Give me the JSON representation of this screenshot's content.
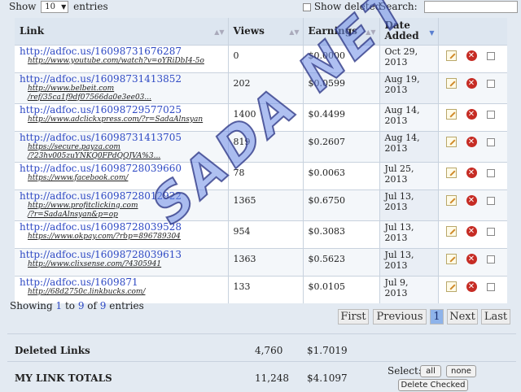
{
  "top": {
    "show_label": "Show",
    "entries_value": "10",
    "entries_label": "entries",
    "show_deleted_label": "Show deleted",
    "search_label": "Search:",
    "search_value": ""
  },
  "table": {
    "headers": {
      "link": "Link",
      "views": "Views",
      "earnings": "Earnings",
      "date_added": "Date Added"
    },
    "rows": [
      {
        "short": "http://adfoc.us/16098731676287",
        "dest": "http://www.youtube.com/watch?v=oYRiDbI4-5o",
        "dest2": "",
        "views": "0",
        "earnings": "$0.0000",
        "date1": "Oct 29,",
        "date2": "2013"
      },
      {
        "short": "http://adfoc.us/16098731413852",
        "dest": "http://www.belbeit.com",
        "dest2": "/ref/35ca1f9df07566da0e3ee03...",
        "views": "202",
        "earnings": "$0.0599",
        "date1": "Aug 19,",
        "date2": "2013"
      },
      {
        "short": "http://adfoc.us/16098729577025",
        "dest": "http://www.adclickxpress.com/?r=SadaAlnsyan",
        "dest2": "",
        "views": "1400",
        "earnings": "$0.4499",
        "date1": "Aug 14,",
        "date2": "2013"
      },
      {
        "short": "http://adfoc.us/16098731413705",
        "dest": "https://secure.payza.com",
        "dest2": "/?23hv005zuYNKQ0FPdQQJVA%3...",
        "views": "819",
        "earnings": "$0.2607",
        "date1": "Aug 14,",
        "date2": "2013"
      },
      {
        "short": "http://adfoc.us/16098728039660",
        "dest": "https://www.facebook.com/",
        "dest2": "",
        "views": "78",
        "earnings": "$0.0063",
        "date1": "Jul 25,",
        "date2": "2013"
      },
      {
        "short": "http://adfoc.us/16098728012922",
        "dest": "http://www.profitclicking.com",
        "dest2": "/?r=SadaAlnsyan&p=op",
        "views": "1365",
        "earnings": "$0.6750",
        "date1": "Jul 13,",
        "date2": "2013"
      },
      {
        "short": "http://adfoc.us/16098728039528",
        "dest": "https://www.okpay.com/?rbp=896789304",
        "dest2": "",
        "views": "954",
        "earnings": "$0.3083",
        "date1": "Jul 13,",
        "date2": "2013"
      },
      {
        "short": "http://adfoc.us/16098728039613",
        "dest": "http://www.clixsense.com/?4305941",
        "dest2": "",
        "views": "1363",
        "earnings": "$0.5623",
        "date1": "Jul 13,",
        "date2": "2013"
      },
      {
        "short": "http://adfoc.us/1609871",
        "dest": "http://68d2750c.linkbucks.com/",
        "dest2": "",
        "views": "133",
        "earnings": "$0.0105",
        "date1": "Jul 9,",
        "date2": "2013"
      }
    ]
  },
  "info": {
    "prefix": "Showing ",
    "from": "1",
    "mid1": " to ",
    "to": "9",
    "mid2": " of ",
    "total": "9",
    "suffix": " entries"
  },
  "pagination": {
    "first": "First",
    "previous": "Previous",
    "current": "1",
    "next": "Next",
    "last": "Last"
  },
  "totals": {
    "deleted_label": "Deleted Links",
    "deleted_views": "4,760",
    "deleted_earnings": "$1.7019",
    "totals_label": "MY LINK TOTALS",
    "total_views": "11,248",
    "total_earnings": "$4.1097"
  },
  "bulk": {
    "select_label": "Select:",
    "all": "all",
    "none": "none",
    "delete_checked": "Delete Checked"
  },
  "icons": {
    "edit": "edit-icon",
    "delete": "delete-icon",
    "sort": "sort-icon",
    "dropdown": "chevron-down-icon"
  },
  "watermark": "SADA NET",
  "colors": {
    "link": "#2e49c4",
    "background": "#e3eaf2",
    "current_page": "#8eb3ea",
    "delete_icon": "#c62c24"
  }
}
